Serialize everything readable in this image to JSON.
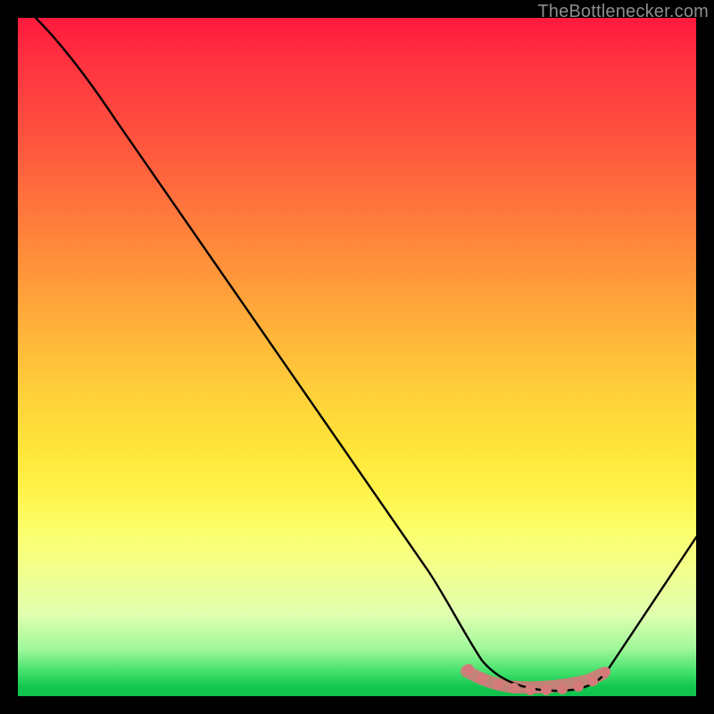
{
  "watermark": "TheBottlenecker.com",
  "colors": {
    "frame": "#000000",
    "curve": "#000000",
    "marker": "#d47a7a",
    "gradient_top": "#ff1a3d",
    "gradient_bottom": "#10c04c"
  },
  "chart_data": {
    "type": "line",
    "title": "",
    "xlabel": "",
    "ylabel": "",
    "xlim": [
      0,
      100
    ],
    "ylim": [
      0,
      100
    ],
    "series": [
      {
        "name": "bottleneck-curve",
        "x": [
          3,
          8,
          14,
          20,
          26,
          32,
          38,
          44,
          50,
          56,
          60,
          64,
          67,
          70,
          73,
          76,
          79,
          82,
          84,
          86,
          90,
          94,
          100
        ],
        "y": [
          100,
          96,
          90.5,
          83,
          75,
          67,
          59,
          51,
          43,
          35,
          29,
          23,
          18,
          13,
          9,
          5.5,
          3,
          1.5,
          1,
          1,
          4,
          11,
          23
        ]
      }
    ],
    "markers": {
      "name": "optimal-range",
      "x": [
        67,
        70,
        72,
        74,
        76,
        78,
        80,
        82,
        84,
        86
      ],
      "y": [
        3.2,
        2.4,
        1.9,
        1.6,
        1.4,
        1.3,
        1.3,
        1.4,
        1.5,
        2.2
      ]
    }
  }
}
